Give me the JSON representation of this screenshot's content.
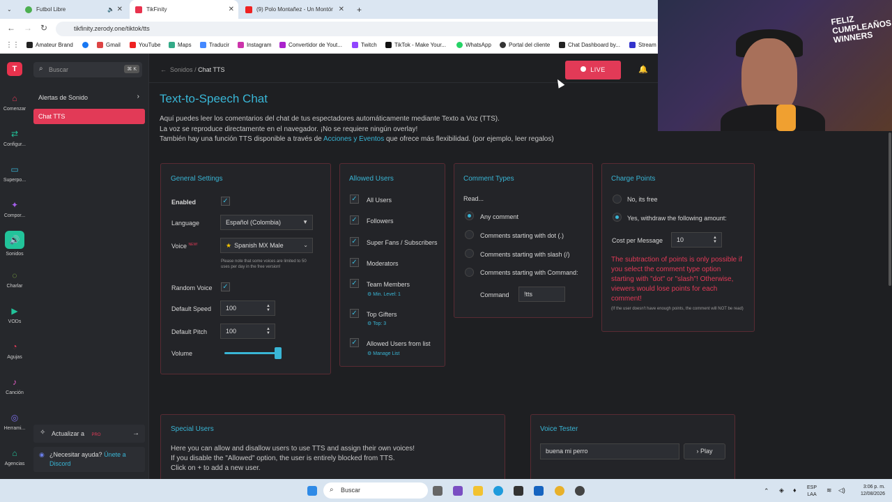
{
  "browser": {
    "tabs": [
      {
        "title": "Futbol Libre"
      },
      {
        "title": "TikFinity"
      },
      {
        "title": "(9) Polo Montañez - Un Montón ..."
      }
    ],
    "url": "tikfinity.zerody.one/tiktok/tts",
    "bookmarks": [
      "Amateur Brand",
      "Gmail",
      "YouTube",
      "Maps",
      "Traducir",
      "Instagram",
      "Convertidor de Yout...",
      "Twitch",
      "TikTok - Make Your...",
      "WhatsApp",
      "Portal del cliente",
      "Chat Dashboard by...",
      "Stream"
    ]
  },
  "sidebar": {
    "logo": "T",
    "rail": [
      "Comenzar",
      "Configur...",
      "Superpo...",
      "Compor...",
      "Sonidos",
      "Charlar",
      "VODs",
      "Agujas",
      "Canción",
      "Herrami...",
      "Agencias"
    ],
    "search_placeholder": "Buscar",
    "search_shortcut": "⌘ K",
    "menu": [
      "Alertas de Sonido",
      "Chat TTS"
    ],
    "upgrade": "Actualizar a",
    "upgrade_badge": "PRO",
    "help": "¿Necesitar ayuda?",
    "help_link": "Únete a Discord"
  },
  "header": {
    "breadcrumb_parent": "Sonidos",
    "breadcrumb_sep": "/",
    "breadcrumb_current": "Chat TTS",
    "live": "LIVE"
  },
  "page": {
    "title": "Text-to-Speech Chat",
    "intro1": "Aquí puedes leer los comentarios del chat de tus espectadores automáticamente mediante Texto a Voz (TTS).",
    "intro2": "La voz se reproduce directamente en el navegador. ¡No se requiere ningún overlay!",
    "intro3_a": "También hay una función TTS disponible a través de ",
    "intro3_link": "Acciones y Eventos",
    "intro3_b": " que ofrece más flexibilidad. (por ejemplo, leer regalos)"
  },
  "general": {
    "title": "General Settings",
    "enabled": "Enabled",
    "language": "Language",
    "language_value": "Español (Colombia)",
    "voice": "Voice",
    "voice_new": "NEW!",
    "voice_value": "Spanish MX Male",
    "voice_note": "Please note that some voices are limited to 50 uses per day in the free version!",
    "random_voice": "Random Voice",
    "speed": "Default Speed",
    "speed_value": "100",
    "pitch": "Default Pitch",
    "pitch_value": "100",
    "volume": "Volume"
  },
  "allowed": {
    "title": "Allowed Users",
    "items": [
      "All Users",
      "Followers",
      "Super Fans / Subscribers",
      "Moderators",
      "Team Members",
      "Top Gifters",
      "Allowed Users from list"
    ],
    "team_sub": "Min. Level: 1",
    "gifters_sub": "Top: 3",
    "list_sub": "Manage List"
  },
  "comment": {
    "title": "Comment Types",
    "read": "Read...",
    "options": [
      "Any comment",
      "Comments starting with dot (.)",
      "Comments starting with slash (/)",
      "Comments starting with Command:"
    ],
    "command_label": "Command",
    "command_value": "!tts"
  },
  "charge": {
    "title": "Charge Points",
    "options": [
      "No, its free",
      "Yes, withdraw the following amount:"
    ],
    "cost_label": "Cost per Message",
    "cost_value": "10",
    "warning": "The subtraction of points is only possible if you select the comment type option starting with \"dot\" or \"slash\"! Otherwise, viewers would lose points for each comment!",
    "note": "(If the user doesn't have enough points, the comment will NOT be read)"
  },
  "special": {
    "title": "Special Users",
    "line1": "Here you can allow and disallow users to use TTS and assign their own voices!",
    "line2": "If you disable the \"Allowed\" option, the user is entirely blocked from TTS.",
    "line3": "Click on + to add a new user."
  },
  "tester": {
    "title": "Voice Tester",
    "input_value": "buena mi perro",
    "play": "Play"
  },
  "taskbar": {
    "search": "Buscar",
    "lang1": "ESP",
    "lang2": "LAA",
    "time": "3:06 p. m.",
    "date": "12/08/2026"
  },
  "webcam": {
    "sign": "FELIZ CUMPLEAÑOS WINNERS"
  }
}
